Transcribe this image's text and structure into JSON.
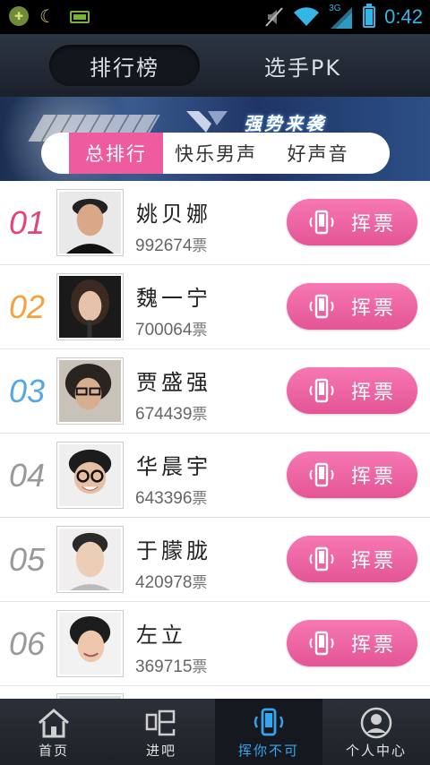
{
  "statusbar": {
    "time": "0:42",
    "network": "3G",
    "icons": [
      "app-icon",
      "moon-icon",
      "battery-small-icon",
      "mute-icon",
      "wifi-icon",
      "signal-icon",
      "battery-icon"
    ]
  },
  "header": {
    "tabs": [
      {
        "label": "排行榜",
        "active": true
      },
      {
        "label": "选手PK",
        "active": false
      }
    ]
  },
  "banner": {
    "slogan": "强势来袭",
    "segments": [
      {
        "label": "总排行",
        "active": true
      },
      {
        "label": "快乐男声",
        "active": false
      },
      {
        "label": "好声音",
        "active": false
      }
    ]
  },
  "list": {
    "vote_label": "挥票",
    "unit": "票",
    "rows": [
      {
        "rank": "01",
        "name": "姚贝娜",
        "votes": "992674",
        "rank_color": "#e2437e"
      },
      {
        "rank": "02",
        "name": "魏一宁",
        "votes": "700064",
        "rank_color": "#f2a33a"
      },
      {
        "rank": "03",
        "name": "贾盛强",
        "votes": "674439",
        "rank_color": "#55a6e6"
      },
      {
        "rank": "04",
        "name": "华晨宇",
        "votes": "643396",
        "rank_color": "#999999"
      },
      {
        "rank": "05",
        "name": "于朦胧",
        "votes": "420978",
        "rank_color": "#999999"
      },
      {
        "rank": "06",
        "name": "左立",
        "votes": "369715",
        "rank_color": "#999999"
      }
    ]
  },
  "bottomnav": {
    "items": [
      {
        "label": "首页",
        "icon": "home-icon",
        "active": false
      },
      {
        "label": "进吧",
        "icon": "forum-icon",
        "active": false
      },
      {
        "label": "挥你不可",
        "icon": "shake-phone-icon",
        "active": true
      },
      {
        "label": "个人中心",
        "icon": "user-icon",
        "active": false
      }
    ]
  },
  "colors": {
    "accent_pink": "#ee5b9e",
    "accent_blue": "#33a6ee",
    "header_bg": "#2d3542"
  }
}
